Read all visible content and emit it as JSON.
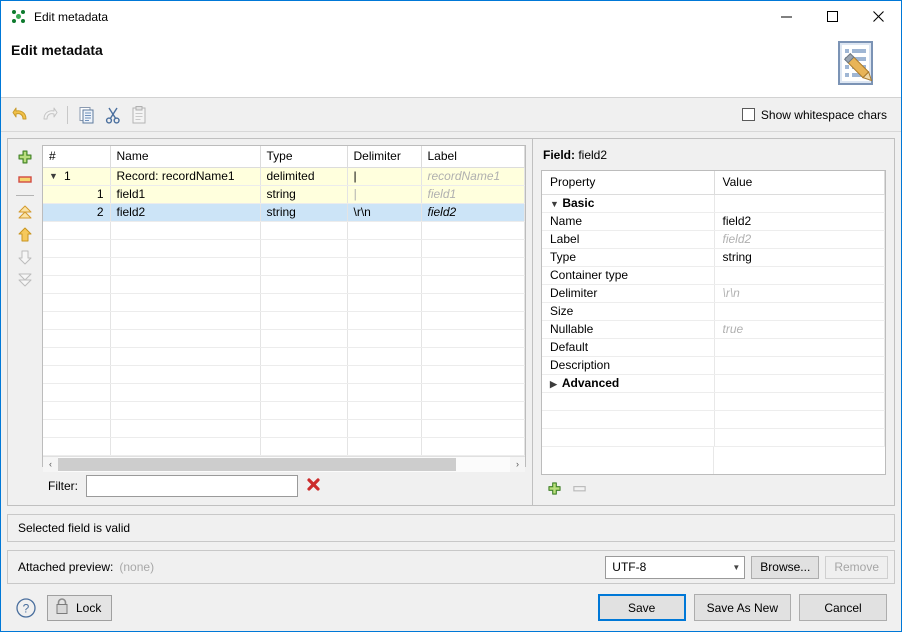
{
  "window": {
    "title": "Edit metadata",
    "icon": "clover-logo-icon",
    "minimize": "—",
    "maximize": "□",
    "close": "✕"
  },
  "header": {
    "title": "Edit metadata",
    "icon": "metadata-edit-icon"
  },
  "toolbar": {
    "undo": "undo-icon",
    "redo": "redo-icon",
    "copy": "copy-icon",
    "cut": "cut-icon",
    "paste": "paste-icon",
    "whitespace_label": "Show whitespace chars",
    "whitespace_checked": false
  },
  "side_tools": [
    {
      "name": "add-field-button",
      "icon": "plus-icon",
      "enabled": true
    },
    {
      "name": "remove-field-button",
      "icon": "minus-icon",
      "enabled": true
    },
    {
      "name": "move-top-button",
      "icon": "double-up-icon",
      "enabled": true
    },
    {
      "name": "move-up-button",
      "icon": "up-icon",
      "enabled": true
    },
    {
      "name": "move-down-button",
      "icon": "down-icon",
      "enabled": false
    },
    {
      "name": "move-bottom-button",
      "icon": "double-down-icon",
      "enabled": false
    }
  ],
  "fields_table": {
    "columns": [
      "#",
      "Name",
      "Type",
      "Delimiter",
      "Label"
    ],
    "rows": [
      {
        "kind": "record",
        "num": "1",
        "name": "Record: recordName1",
        "type": "delimited",
        "delimiter": "|",
        "label": "recordName1",
        "label_ghost": true,
        "delimiter_ghost": false,
        "selected": false,
        "expanded": true
      },
      {
        "kind": "field",
        "num": "1",
        "name": "field1",
        "type": "string",
        "delimiter": "|",
        "label": "field1",
        "label_ghost": true,
        "delimiter_ghost": true,
        "selected": false
      },
      {
        "kind": "field",
        "num": "2",
        "name": "field2",
        "type": "string",
        "delimiter": "\\r\\n",
        "label": "field2",
        "label_ghost": false,
        "delimiter_ghost": false,
        "selected": true
      }
    ],
    "empty_row_count": 12
  },
  "scrollbar": {
    "left_arrow": "‹",
    "right_arrow": "›"
  },
  "filter": {
    "label": "Filter:",
    "value": "",
    "placeholder": "",
    "clear_icon": "red-x-icon"
  },
  "details": {
    "heading_prefix": "Field:",
    "heading_value": "field2",
    "columns": [
      "Property",
      "Value"
    ],
    "rows": [
      {
        "kind": "group",
        "property": "Basic",
        "value": "",
        "expanded": true
      },
      {
        "kind": "prop",
        "property": "Name",
        "value": "field2",
        "ghost": false
      },
      {
        "kind": "prop",
        "property": "Label",
        "value": "field2",
        "ghost": true
      },
      {
        "kind": "prop",
        "property": "Type",
        "value": "string",
        "ghost": false
      },
      {
        "kind": "prop",
        "property": "Container type",
        "value": "",
        "ghost": false
      },
      {
        "kind": "prop",
        "property": "Delimiter",
        "value": "\\r\\n",
        "ghost": true
      },
      {
        "kind": "prop",
        "property": "Size",
        "value": "",
        "ghost": false
      },
      {
        "kind": "prop",
        "property": "Nullable",
        "value": "true",
        "ghost": true
      },
      {
        "kind": "prop",
        "property": "Default",
        "value": "",
        "ghost": false
      },
      {
        "kind": "prop",
        "property": "Description",
        "value": "",
        "ghost": false
      },
      {
        "kind": "group",
        "property": "Advanced",
        "value": "",
        "expanded": false
      }
    ],
    "add_button": "plus-icon",
    "remove_button": "minus-icon"
  },
  "status": {
    "message": "Selected field is valid"
  },
  "preview": {
    "label": "Attached preview:",
    "value": "(none)",
    "encoding": "UTF-8",
    "browse_label": "Browse...",
    "remove_label": "Remove",
    "remove_enabled": false
  },
  "footer": {
    "help_icon": "help-icon",
    "lock_label": "Lock",
    "lock_icon": "lock-icon",
    "save_label": "Save",
    "save_as_new_label": "Save As New",
    "cancel_label": "Cancel"
  },
  "colors": {
    "accent": "#0078d7",
    "record_row": "#ffffdd",
    "selected_row": "#cce4f7",
    "ghost_text": "#b0b0b0"
  }
}
